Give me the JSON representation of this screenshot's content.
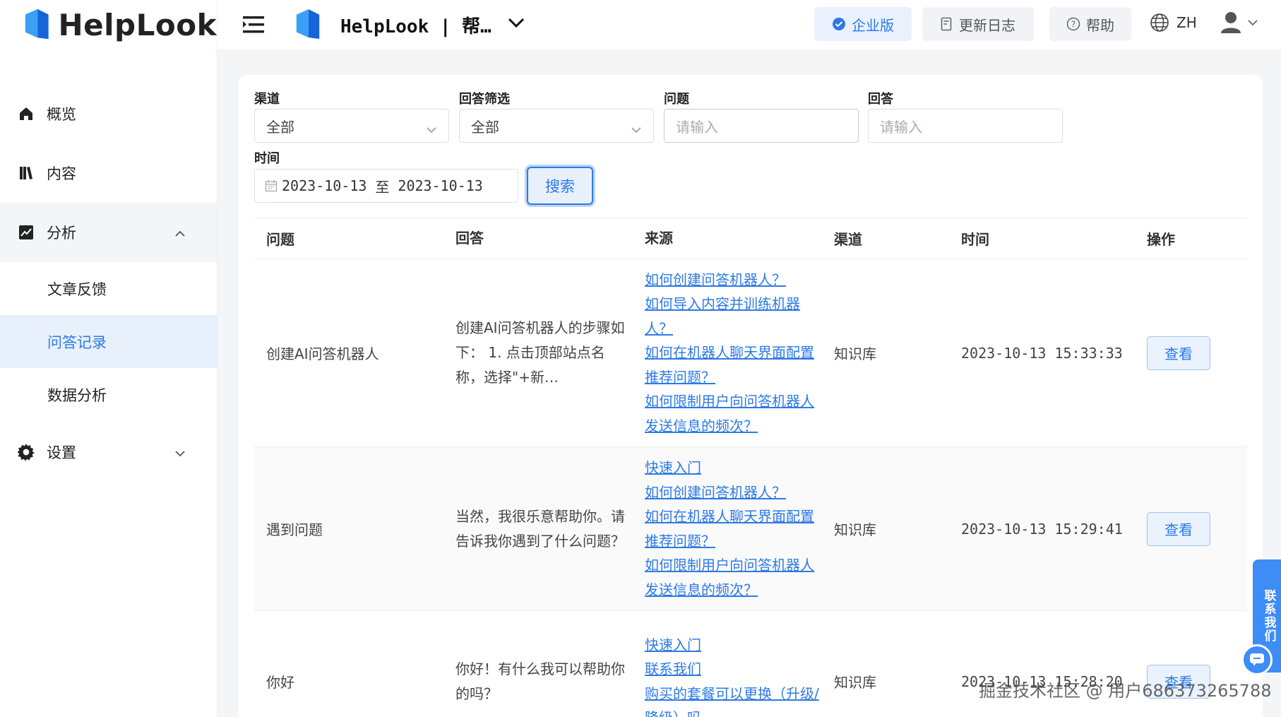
{
  "brand": {
    "logo_text": "HelpLook",
    "accent": "#2d7ae6"
  },
  "sidebar": {
    "items": [
      {
        "label": "概览",
        "icon": "home-icon"
      },
      {
        "label": "内容",
        "icon": "book-icon"
      },
      {
        "label": "分析",
        "icon": "chart-icon",
        "expanded": true
      },
      {
        "label": "设置",
        "icon": "gear-icon"
      }
    ],
    "analysis_sub": [
      {
        "label": "文章反馈"
      },
      {
        "label": "问答记录",
        "active": true
      },
      {
        "label": "数据分析"
      }
    ]
  },
  "header": {
    "site_name": "HelpLook | 帮…",
    "enterprise": "企业版",
    "changelog": "更新日志",
    "help": "帮助",
    "lang": "ZH"
  },
  "filters": {
    "channel_label": "渠道",
    "channel_value": "全部",
    "answer_filter_label": "回答筛选",
    "answer_filter_value": "全部",
    "question_label": "问题",
    "question_placeholder": "请输入",
    "answer_label": "回答",
    "answer_placeholder": "请输入",
    "time_label": "时间",
    "date_start": "2023-10-13",
    "date_sep": "至",
    "date_end": "2023-10-13",
    "search": "搜索"
  },
  "table": {
    "headers": [
      "问题",
      "回答",
      "来源",
      "渠道",
      "时间",
      "操作"
    ],
    "rows": [
      {
        "question": "创建AI问答机器人",
        "answer": "创建AI问答机器人的步骤如下： 1. 点击顶部站点名称，选择\"+新…",
        "sources": [
          "如何创建问答机器人？",
          "如何导入内容并训练机器人？",
          "如何在机器人聊天界面配置推荐问题？",
          "如何限制用户向问答机器人发送信息的频次？"
        ],
        "channel": "知识库",
        "time": "2023-10-13 15:33:33",
        "action": "查看"
      },
      {
        "question": "遇到问题",
        "answer": "当然，我很乐意帮助你。请告诉我你遇到了什么问题？",
        "sources": [
          "快速入门",
          "如何创建问答机器人？",
          "如何在机器人聊天界面配置推荐问题？",
          "如何限制用户向问答机器人发送信息的频次？"
        ],
        "channel": "知识库",
        "time": "2023-10-13 15:29:41",
        "action": "查看"
      },
      {
        "question": "你好",
        "answer": "你好！有什么我可以帮助你的吗？",
        "sources": [
          "快速入门",
          "联系我们",
          "购买的套餐可以更换（升级/降级）吗"
        ],
        "channel": "知识库",
        "time": "2023-10-13 15:28:20",
        "action": "查看"
      }
    ]
  },
  "float": {
    "contact": "联系我们"
  },
  "watermark": "掘金技术社区 @ 用户686373265788"
}
